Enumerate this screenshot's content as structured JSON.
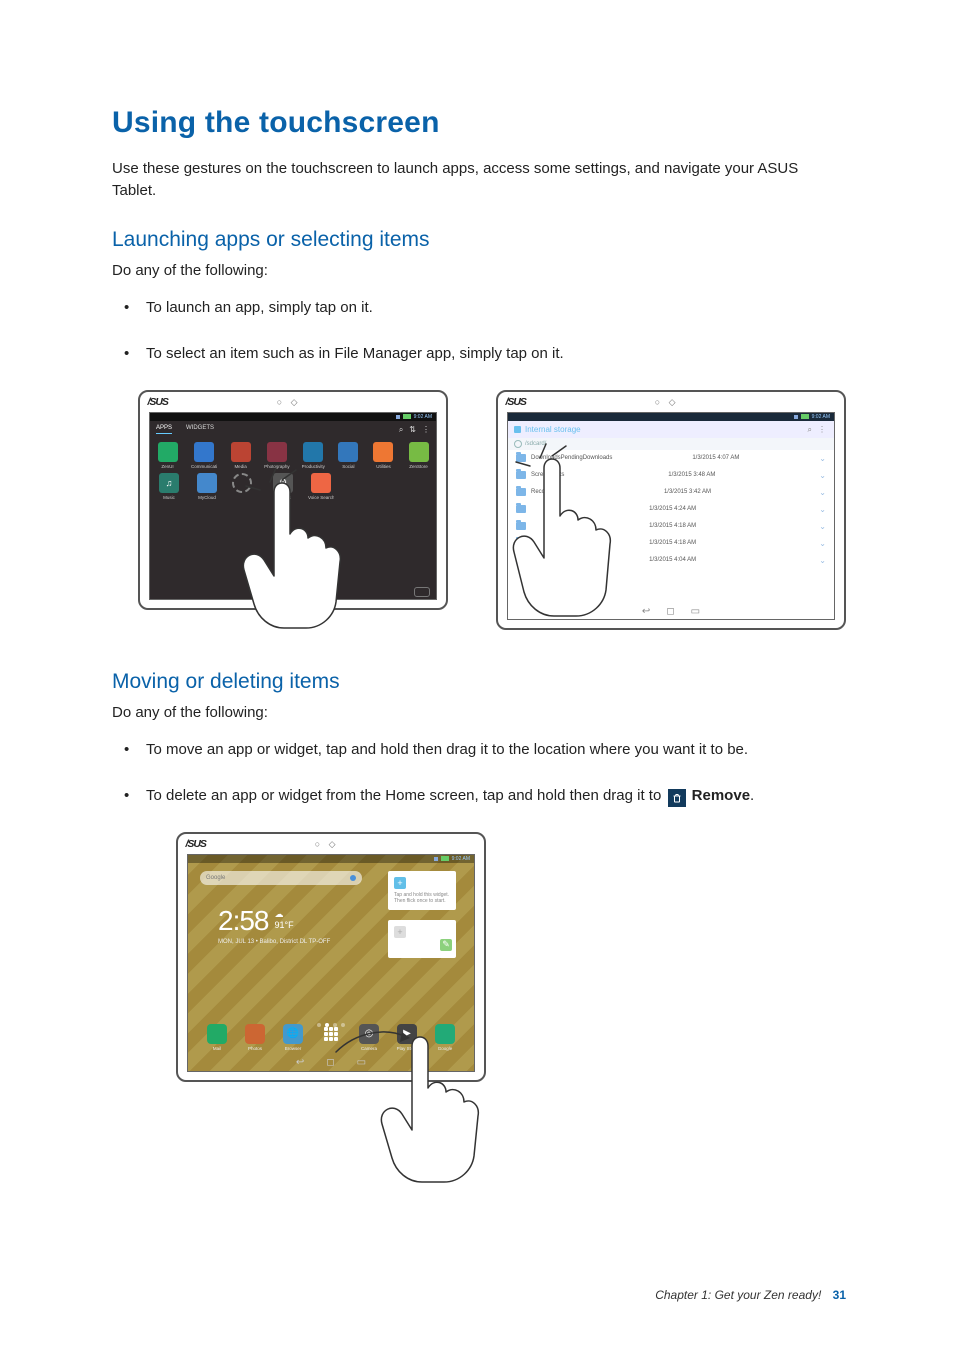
{
  "page": {
    "title": "Using the touchscreen",
    "lead": "Use these gestures on the touchscreen to launch apps, access some settings, and navigate your ASUS Tablet."
  },
  "section1": {
    "heading": "Launching apps or selecting items",
    "intro": "Do any of the following:",
    "bullets": [
      "To launch an app, simply tap on it.",
      "To select an item such as in File Manager app, simply tap on it."
    ]
  },
  "section2": {
    "heading": "Moving or deleting items",
    "intro": "Do any of the following:",
    "bullet_move": "To move an app or widget, tap and hold then drag it to the location where you want it to be.",
    "bullet_del_prefix": "To delete an app or widget from the Home screen, tap and hold then drag it to ",
    "bullet_del_bold": "Remove",
    "bullet_del_suffix": "."
  },
  "device": {
    "logo": "/SUS",
    "dots": "○  ◇"
  },
  "apps_fig": {
    "status_time": "9:02 AM",
    "tab_apps": "APPS",
    "tab_widgets": "WIDGETS",
    "row1": [
      {
        "label": "ZenUI",
        "cls": "ic-asus"
      },
      {
        "label": "Communication",
        "cls": "ic-comm"
      },
      {
        "label": "Media",
        "cls": "ic-media"
      },
      {
        "label": "Photography",
        "cls": "ic-photo"
      },
      {
        "label": "Productivity",
        "cls": "ic-prod"
      },
      {
        "label": "Social",
        "cls": "ic-social"
      },
      {
        "label": "Utilities",
        "cls": "ic-utils"
      },
      {
        "label": "ZenStore",
        "cls": "ic-zen"
      }
    ],
    "row2": [
      {
        "label": "Music",
        "cls": "ic-music",
        "glyph": "♫"
      },
      {
        "label": "MyCloud",
        "cls": "ic-mycloud",
        "glyph": ""
      },
      {
        "label": "",
        "cls": "ic-note",
        "glyph": ""
      },
      {
        "label": "Settings",
        "cls": "ic-set",
        "glyph": "⚙"
      },
      {
        "label": "Voice Search",
        "cls": "ic-voice",
        "glyph": "🎤"
      }
    ]
  },
  "fm_fig": {
    "status_time": "9:02 AM",
    "header": "Internal storage",
    "path": "/sdcard/",
    "rows": [
      {
        "name": "DownloadsPendingDownloads",
        "date": "1/3/2015  4:07 AM"
      },
      {
        "name": "Screenshots",
        "date": "1/3/2015  3:48 AM"
      },
      {
        "name": "Recorder",
        "date": "1/3/2015  3:42 AM"
      },
      {
        "name": "",
        "date": "1/3/2015  4:24 AM"
      },
      {
        "name": "",
        "date": "1/3/2015  4:18 AM"
      },
      {
        "name": "",
        "date": "1/3/2015  4:18 AM"
      },
      {
        "name": "",
        "date": "1/3/2015  4:04 AM"
      }
    ]
  },
  "home_fig": {
    "status_time": "9:02 AM",
    "search": "Google",
    "time": "2:58",
    "temp": "91°F",
    "date": "MON, JUL 13 • Balibo, District DL TP-OFF",
    "card1": "Tap and hold this widget. Then flick once to start.",
    "dock": [
      {
        "label": "Mail",
        "cls": "di-mail"
      },
      {
        "label": "Photos",
        "cls": "di-photos"
      },
      {
        "label": "Browser",
        "cls": "di-browser",
        "glyph": "🌐"
      },
      {
        "label": "",
        "cls": "di-apps"
      },
      {
        "label": "Camera",
        "cls": "di-cam",
        "glyph": "◎"
      },
      {
        "label": "Play Store",
        "cls": "di-play",
        "glyph": "▶"
      },
      {
        "label": "Google",
        "cls": "di-google"
      }
    ]
  },
  "footer": {
    "chapter": "Chapter 1: Get your Zen ready!",
    "page_number": "31"
  }
}
